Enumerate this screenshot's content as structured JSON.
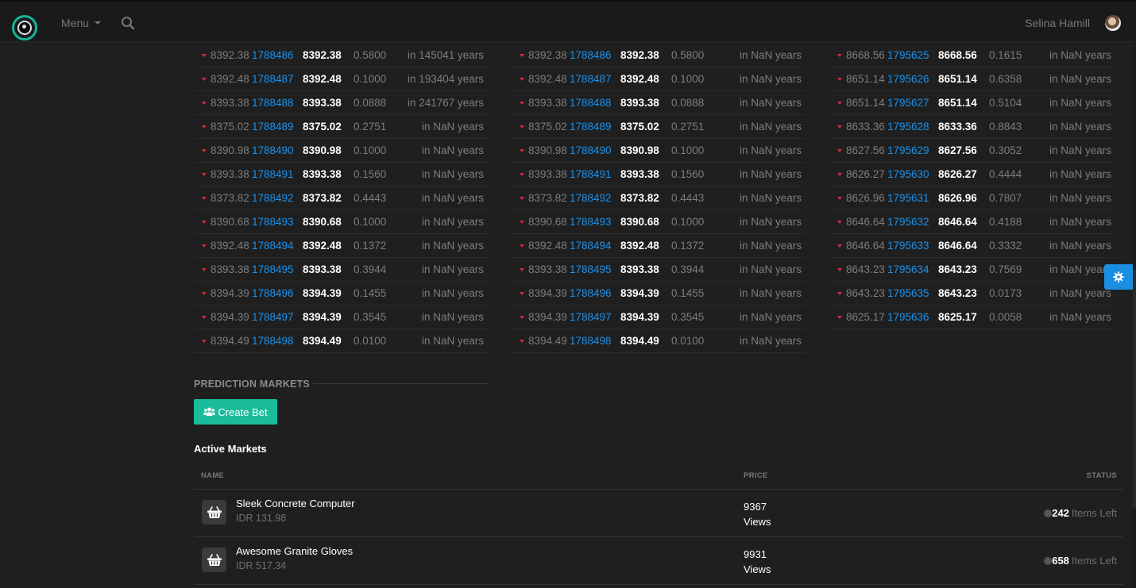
{
  "header": {
    "menu_label": "Menu",
    "user_name": "Selina Hamill",
    "icons": [
      "logo-icon",
      "chevron-down-icon",
      "search-icon",
      "avatar"
    ]
  },
  "trade_columns": [
    {
      "rows": [
        {
          "old": "8392.38",
          "id": "1788486",
          "price": "8392.38",
          "size": "0.5800",
          "time": "in 145041 years"
        },
        {
          "old": "8392.48",
          "id": "1788487",
          "price": "8392.48",
          "size": "0.1000",
          "time": "in 193404 years"
        },
        {
          "old": "8393.38",
          "id": "1788488",
          "price": "8393.38",
          "size": "0.0888",
          "time": "in 241767 years"
        },
        {
          "old": "8375.02",
          "id": "1788489",
          "price": "8375.02",
          "size": "0.2751",
          "time": "in NaN years"
        },
        {
          "old": "8390.98",
          "id": "1788490",
          "price": "8390.98",
          "size": "0.1000",
          "time": "in NaN years"
        },
        {
          "old": "8393.38",
          "id": "1788491",
          "price": "8393.38",
          "size": "0.1560",
          "time": "in NaN years"
        },
        {
          "old": "8373.82",
          "id": "1788492",
          "price": "8373.82",
          "size": "0.4443",
          "time": "in NaN years"
        },
        {
          "old": "8390.68",
          "id": "1788493",
          "price": "8390.68",
          "size": "0.1000",
          "time": "in NaN years"
        },
        {
          "old": "8392.48",
          "id": "1788494",
          "price": "8392.48",
          "size": "0.1372",
          "time": "in NaN years"
        },
        {
          "old": "8393.38",
          "id": "1788495",
          "price": "8393.38",
          "size": "0.3944",
          "time": "in NaN years"
        },
        {
          "old": "8394.39",
          "id": "1788496",
          "price": "8394.39",
          "size": "0.1455",
          "time": "in NaN years"
        },
        {
          "old": "8394.39",
          "id": "1788497",
          "price": "8394.39",
          "size": "0.3545",
          "time": "in NaN years"
        },
        {
          "old": "8394.49",
          "id": "1788498",
          "price": "8394.49",
          "size": "0.0100",
          "time": "in NaN years"
        }
      ]
    },
    {
      "rows": [
        {
          "old": "8392.38",
          "id": "1788486",
          "price": "8392.38",
          "size": "0.5800",
          "time": "in NaN years"
        },
        {
          "old": "8392.48",
          "id": "1788487",
          "price": "8392.48",
          "size": "0.1000",
          "time": "in NaN years"
        },
        {
          "old": "8393.38",
          "id": "1788488",
          "price": "8393.38",
          "size": "0.0888",
          "time": "in NaN years"
        },
        {
          "old": "8375.02",
          "id": "1788489",
          "price": "8375.02",
          "size": "0.2751",
          "time": "in NaN years"
        },
        {
          "old": "8390.98",
          "id": "1788490",
          "price": "8390.98",
          "size": "0.1000",
          "time": "in NaN years"
        },
        {
          "old": "8393.38",
          "id": "1788491",
          "price": "8393.38",
          "size": "0.1560",
          "time": "in NaN years"
        },
        {
          "old": "8373.82",
          "id": "1788492",
          "price": "8373.82",
          "size": "0.4443",
          "time": "in NaN years"
        },
        {
          "old": "8390.68",
          "id": "1788493",
          "price": "8390.68",
          "size": "0.1000",
          "time": "in NaN years"
        },
        {
          "old": "8392.48",
          "id": "1788494",
          "price": "8392.48",
          "size": "0.1372",
          "time": "in NaN years"
        },
        {
          "old": "8393.38",
          "id": "1788495",
          "price": "8393.38",
          "size": "0.3944",
          "time": "in NaN years"
        },
        {
          "old": "8394.39",
          "id": "1788496",
          "price": "8394.39",
          "size": "0.1455",
          "time": "in NaN years"
        },
        {
          "old": "8394.39",
          "id": "1788497",
          "price": "8394.39",
          "size": "0.3545",
          "time": "in NaN years"
        },
        {
          "old": "8394.49",
          "id": "1788498",
          "price": "8394.49",
          "size": "0.0100",
          "time": "in NaN years"
        }
      ]
    },
    {
      "rows": [
        {
          "old": "8668.56",
          "id": "1795625",
          "price": "8668.56",
          "size": "0.1615",
          "time": "in NaN years"
        },
        {
          "old": "8651.14",
          "id": "1795626",
          "price": "8651.14",
          "size": "0.6358",
          "time": "in NaN years"
        },
        {
          "old": "8651.14",
          "id": "1795627",
          "price": "8651.14",
          "size": "0.5104",
          "time": "in NaN years"
        },
        {
          "old": "8633.36",
          "id": "1795628",
          "price": "8633.36",
          "size": "0.8843",
          "time": "in NaN years"
        },
        {
          "old": "8627.56",
          "id": "1795629",
          "price": "8627.56",
          "size": "0.3052",
          "time": "in NaN years"
        },
        {
          "old": "8626.27",
          "id": "1795630",
          "price": "8626.27",
          "size": "0.4444",
          "time": "in NaN years"
        },
        {
          "old": "8626.96",
          "id": "1795631",
          "price": "8626.96",
          "size": "0.7807",
          "time": "in NaN years"
        },
        {
          "old": "8646.64",
          "id": "1795632",
          "price": "8646.64",
          "size": "0.4188",
          "time": "in NaN years"
        },
        {
          "old": "8646.64",
          "id": "1795633",
          "price": "8646.64",
          "size": "0.3332",
          "time": "in NaN years"
        },
        {
          "old": "8643.23",
          "id": "1795634",
          "price": "8643.23",
          "size": "0.7569",
          "time": "in NaN years"
        },
        {
          "old": "8643.23",
          "id": "1795635",
          "price": "8643.23",
          "size": "0.0173",
          "time": "in NaN years"
        },
        {
          "old": "8625.17",
          "id": "1795636",
          "price": "8625.17",
          "size": "0.0058",
          "time": "in NaN years"
        }
      ]
    }
  ],
  "prediction": {
    "section_title": "PREDICTION MARKETS",
    "create_bet_label": "Create Bet",
    "active_title": "Active Markets",
    "columns": {
      "name": "NAME",
      "price": "PRICE",
      "status": "STATUS"
    },
    "markets": [
      {
        "name": "Sleek Concrete Computer",
        "sub": "IDR 131.98",
        "views_count": "9367",
        "views_label": "Views",
        "items_left": "242",
        "items_label": "Items Left"
      },
      {
        "name": "Awesome Granite Gloves",
        "sub": "IDR 517.34",
        "views_count": "9931",
        "views_label": "Views",
        "items_left": "658",
        "items_label": "Items Left"
      }
    ]
  },
  "colors": {
    "accent_teal": "#1bbc9b",
    "link_blue": "#1e90e8",
    "down_red": "#e0243a",
    "settings_blue": "#1a8ee0"
  }
}
